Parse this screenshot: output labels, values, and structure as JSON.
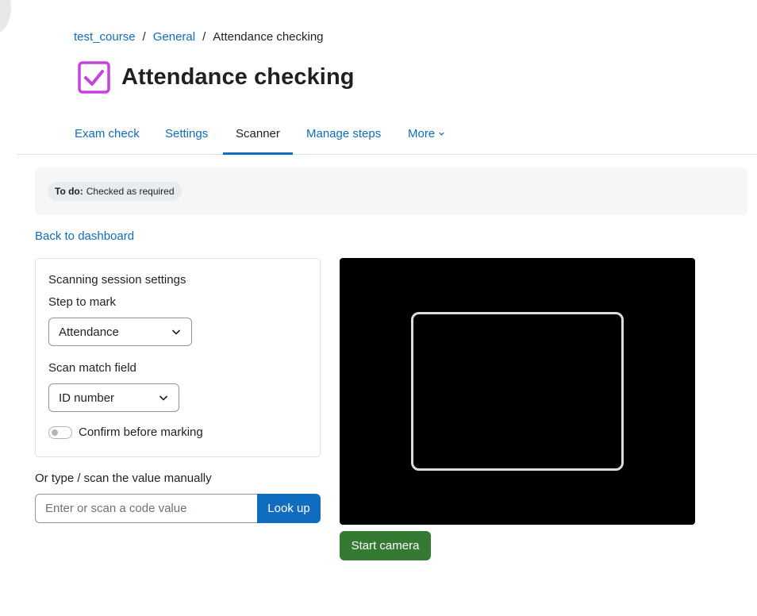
{
  "breadcrumb": {
    "items": [
      "test_course",
      "General"
    ],
    "separator": "/",
    "current": "Attendance checking"
  },
  "page": {
    "title": "Attendance checking",
    "icon": "checkbox-icon",
    "icon_color": "#c444db"
  },
  "nav": {
    "tabs": [
      {
        "label": "Exam check"
      },
      {
        "label": "Settings"
      },
      {
        "label": "Scanner",
        "active": true
      },
      {
        "label": "Manage steps"
      },
      {
        "label": "More"
      }
    ]
  },
  "status": {
    "todo_label": "To do:",
    "todo_value": "Checked as required"
  },
  "back_link": "Back to dashboard",
  "settings": {
    "title": "Scanning session settings",
    "step_label": "Step to mark",
    "step_value": "Attendance",
    "match_label": "Scan match field",
    "match_value": "ID number",
    "confirm_label": "Confirm before marking",
    "confirm_enabled": false
  },
  "manual": {
    "label": "Or type / scan the value manually",
    "placeholder": "Enter or scan a code value",
    "button": "Look up"
  },
  "camera": {
    "start_button": "Start camera"
  },
  "colors": {
    "link": "#0f6cbf",
    "primary_button": "#0f6cbf",
    "success_button": "#357a32",
    "camera_bg": "#000000"
  }
}
